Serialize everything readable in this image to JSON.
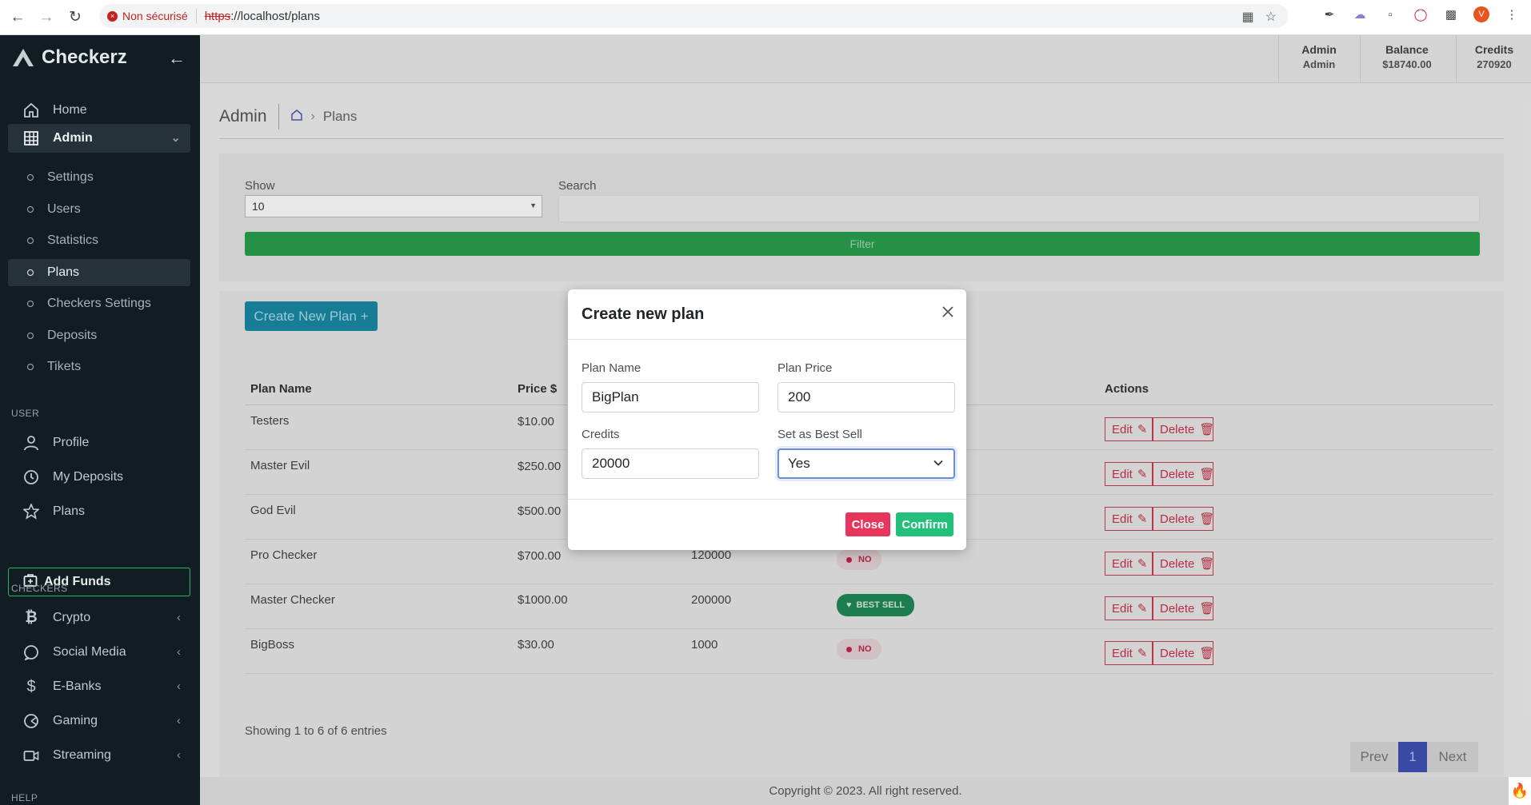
{
  "browser": {
    "not_secure": "Non sécurisé",
    "url_scheme": "https",
    "url_rest": "://localhost/plans"
  },
  "sidebar": {
    "brand": "Checkerz",
    "items": [
      {
        "label": "Home",
        "icon": "home-icon"
      },
      {
        "label": "Admin",
        "icon": "grid-icon"
      }
    ],
    "admin_sub": [
      "Settings",
      "Users",
      "Statistics",
      "Plans",
      "Checkers Settings",
      "Deposits",
      "Tikets"
    ],
    "user_header": "USER",
    "user_items": [
      {
        "label": "Profile",
        "icon": "user-icon"
      },
      {
        "label": "My Deposits",
        "icon": "history-icon"
      },
      {
        "label": "Plans",
        "icon": "star-icon"
      }
    ],
    "add_funds": "Add Funds",
    "checkers_header": "CHECKERS",
    "checkers_items": [
      {
        "label": "Crypto",
        "icon": "bitcoin-icon"
      },
      {
        "label": "Social Media",
        "icon": "chat-icon"
      },
      {
        "label": "E-Banks",
        "icon": "dollar-icon"
      },
      {
        "label": "Gaming",
        "icon": "gaming-icon"
      },
      {
        "label": "Streaming",
        "icon": "video-icon"
      }
    ],
    "help_header": "HELP"
  },
  "topbar": {
    "admin_label": "Admin",
    "admin_value": "Admin",
    "balance_label": "Balance",
    "balance_value": "$18740.00",
    "credits_label": "Credits",
    "credits_value": "270920"
  },
  "page": {
    "title": "Admin",
    "breadcrumb": "Plans"
  },
  "filters": {
    "show_label": "Show",
    "show_value": "10",
    "search_label": "Search",
    "filter_button": "Filter"
  },
  "create_button": "Create New Plan +",
  "table": {
    "headers": [
      "Plan Name",
      "Price $",
      "",
      "",
      "Actions"
    ],
    "rows": [
      {
        "name": "Testers",
        "price": "$10.00",
        "credits": "",
        "badge": "",
        "badge_type": ""
      },
      {
        "name": "Master Evil",
        "price": "$250.00",
        "credits": "",
        "badge": "",
        "badge_type": ""
      },
      {
        "name": "God Evil",
        "price": "$500.00",
        "credits": "",
        "badge": "",
        "badge_type": ""
      },
      {
        "name": "Pro Checker",
        "price": "$700.00",
        "credits": "120000",
        "badge": "NO",
        "badge_type": "no"
      },
      {
        "name": "Master Checker",
        "price": "$1000.00",
        "credits": "200000",
        "badge": "BEST SELL",
        "badge_type": "best"
      },
      {
        "name": "BigBoss",
        "price": "$30.00",
        "credits": "1000",
        "badge": "NO",
        "badge_type": "no"
      }
    ],
    "edit_label": "Edit",
    "delete_label": "Delete"
  },
  "pagination": {
    "showing": "Showing 1 to 6 of 6 entries",
    "prev": "Prev",
    "page": "1",
    "next": "Next"
  },
  "footer": "Copyright © 2023. All right reserved.",
  "modal": {
    "title": "Create new plan",
    "plan_name_label": "Plan Name",
    "plan_name_value": "BigPlan",
    "plan_price_label": "Plan Price",
    "plan_price_value": "200",
    "credits_label": "Credits",
    "credits_value": "20000",
    "best_sell_label": "Set as Best Sell",
    "best_sell_value": "Yes",
    "close_button": "Close",
    "confirm_button": "Confirm"
  },
  "colors": {
    "sidebar_bg": "#111c23",
    "accent_green": "#28a04f",
    "create_blue": "#1a8aa7",
    "danger": "#e8355b",
    "confirm": "#22c07a",
    "page_active": "#3f51b5"
  }
}
